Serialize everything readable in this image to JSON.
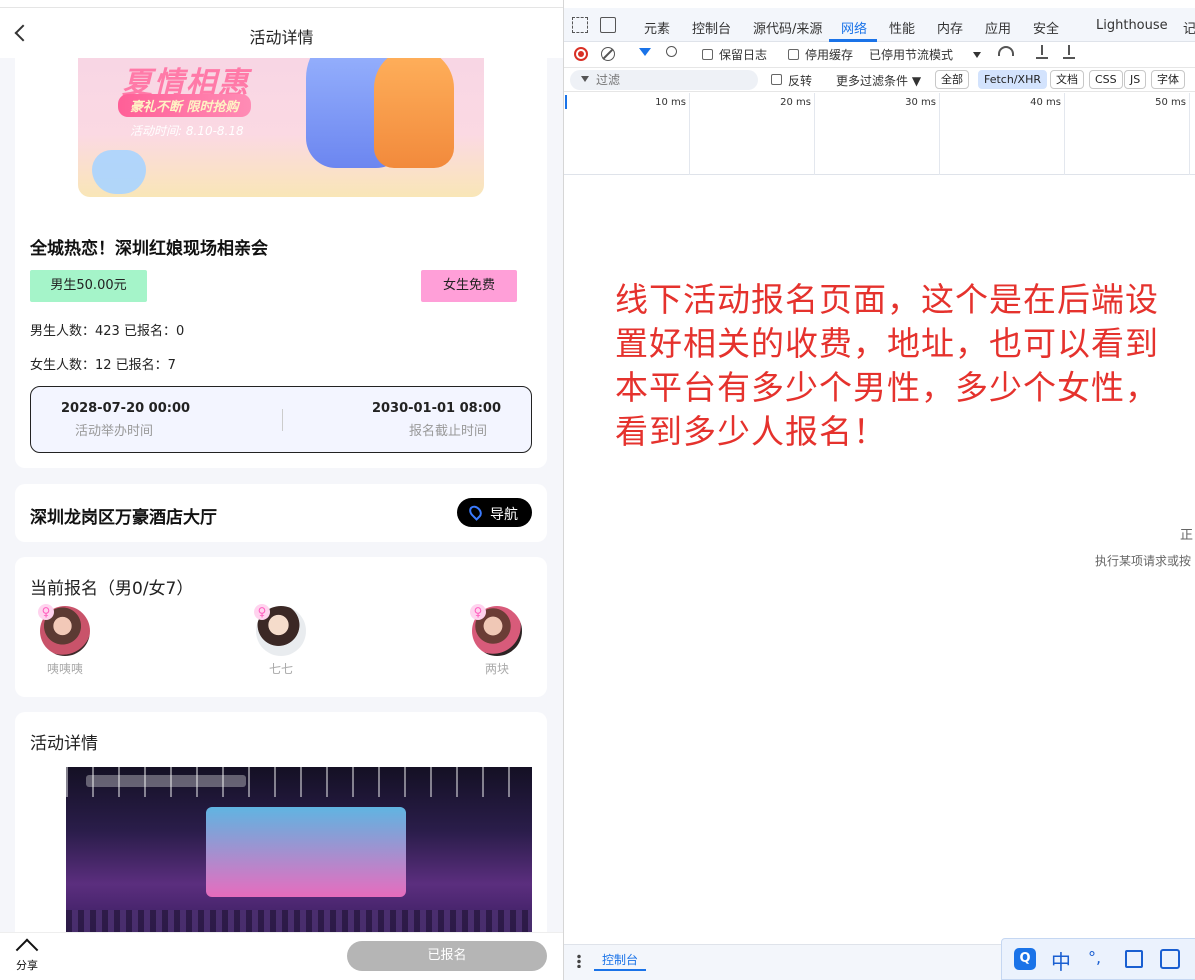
{
  "mobile": {
    "nav_title": "活动详情",
    "banner": {
      "title": "夏情相惠",
      "pill": "豪礼不断 限时抢购",
      "date": "活动时间: 8.10-8.18"
    },
    "event_title": "全城热恋！深圳红娘现场相亲会",
    "price_male": "男生50.00元",
    "price_female": "女生免费",
    "stat_male": "男生人数：423 已报名：0",
    "stat_female": "女生人数：12 已报名：7",
    "time_start": {
      "value": "2028-07-20 00:00",
      "label": "活动举办时间"
    },
    "time_deadline": {
      "value": "2030-01-01 08:00",
      "label": "报名截止时间"
    },
    "address": "深圳龙岗区万豪酒店大厅",
    "nav_button": "导航",
    "signup_title": "当前报名（男0/女7）",
    "members": [
      {
        "name": "咦咦咦",
        "gender_symbol": "♀"
      },
      {
        "name": "七七",
        "gender_symbol": "♀"
      },
      {
        "name": "两块",
        "gender_symbol": "♀"
      }
    ],
    "detail_title": "活动详情",
    "share_label": "分享",
    "registered_label": "已报名"
  },
  "devtools": {
    "tabs": [
      "元素",
      "控制台",
      "源代码/来源",
      "网络",
      "性能",
      "内存",
      "应用",
      "安全",
      "Lighthouse",
      "记"
    ],
    "active_tab": "网络",
    "toolbar": {
      "preserve_log": "保留日志",
      "disable_cache": "停用缓存",
      "throttle": "已停用节流模式"
    },
    "filter": {
      "placeholder": "过滤",
      "invert": "反转",
      "more_filters": "更多过滤条件 ▼",
      "chips": [
        "全部",
        "Fetch/XHR",
        "文档",
        "CSS",
        "JS",
        "字体"
      ],
      "active_chip": "Fetch/XHR"
    },
    "timeline_labels": [
      "10 ms",
      "20 ms",
      "30 ms",
      "40 ms",
      "50 ms"
    ],
    "empty_line_1": "正",
    "empty_line_2": "执行某项请求或按",
    "drawer_tab": "控制台"
  },
  "annotation": "线下活动报名页面，这个是在后端设置好相关的收费，地址，也可以看到本平台有多少个男性，多少个女性，看到多少人报名！",
  "ime": {
    "logo": "Q",
    "mode": "中",
    "punct": "°,"
  },
  "colors": {
    "male_price_bg": "#a5f4c9",
    "female_price_bg": "#ff9fd8",
    "accent_blue": "#1a73e8",
    "annotation_red": "#e5322d",
    "registered_bg": "#b5b5b5"
  }
}
